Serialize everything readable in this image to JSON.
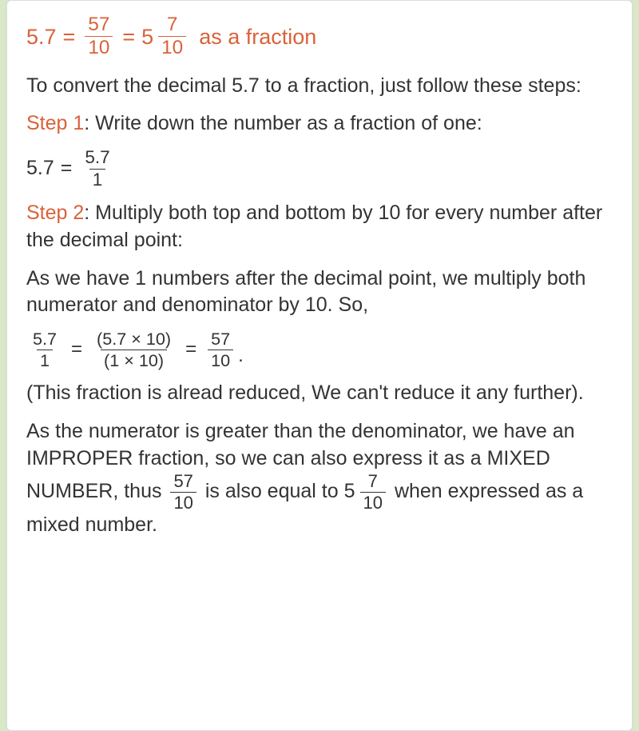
{
  "title": {
    "lhs": "5.7",
    "eq": "=",
    "frac1": {
      "num": "57",
      "den": "10"
    },
    "eq2": "=",
    "mixed": {
      "whole": "5",
      "num": "7",
      "den": "10"
    },
    "suffix": "as a fraction"
  },
  "intro": "To convert the decimal 5.7 to a fraction, just follow these steps:",
  "step1": {
    "label": "Step 1",
    "text": ": Write down the number as a fraction of one:",
    "eq": {
      "lhs": "5.7",
      "op": "=",
      "frac": {
        "num": "5.7",
        "den": "1"
      }
    }
  },
  "step2": {
    "label": "Step 2",
    "text": ": Multiply both top and bottom by 10 for every number after the decimal point:",
    "explain": "As we have 1 numbers after the decimal point, we multiply both numerator and denominator by 10. So,",
    "eq": {
      "f1": {
        "num": "5.7",
        "den": "1"
      },
      "op1": "=",
      "f2": {
        "num": "(5.7 × 10)",
        "den": "(1 × 10)"
      },
      "op2": "=",
      "f3": {
        "num": "57",
        "den": "10"
      },
      "dot": "."
    }
  },
  "note": "(This fraction is alread reduced, We can't reduce it any further).",
  "improper": {
    "part1": "As the numerator is greater than the denominator, we have an IMPROPER fraction, so we can also express it as a MIXED NUMBER, thus ",
    "f1": {
      "num": "57",
      "den": "10"
    },
    "mid": " is also equal to ",
    "mixed": {
      "whole": "5",
      "num": "7",
      "den": "10"
    },
    "part2": " when expressed as a mixed number."
  }
}
